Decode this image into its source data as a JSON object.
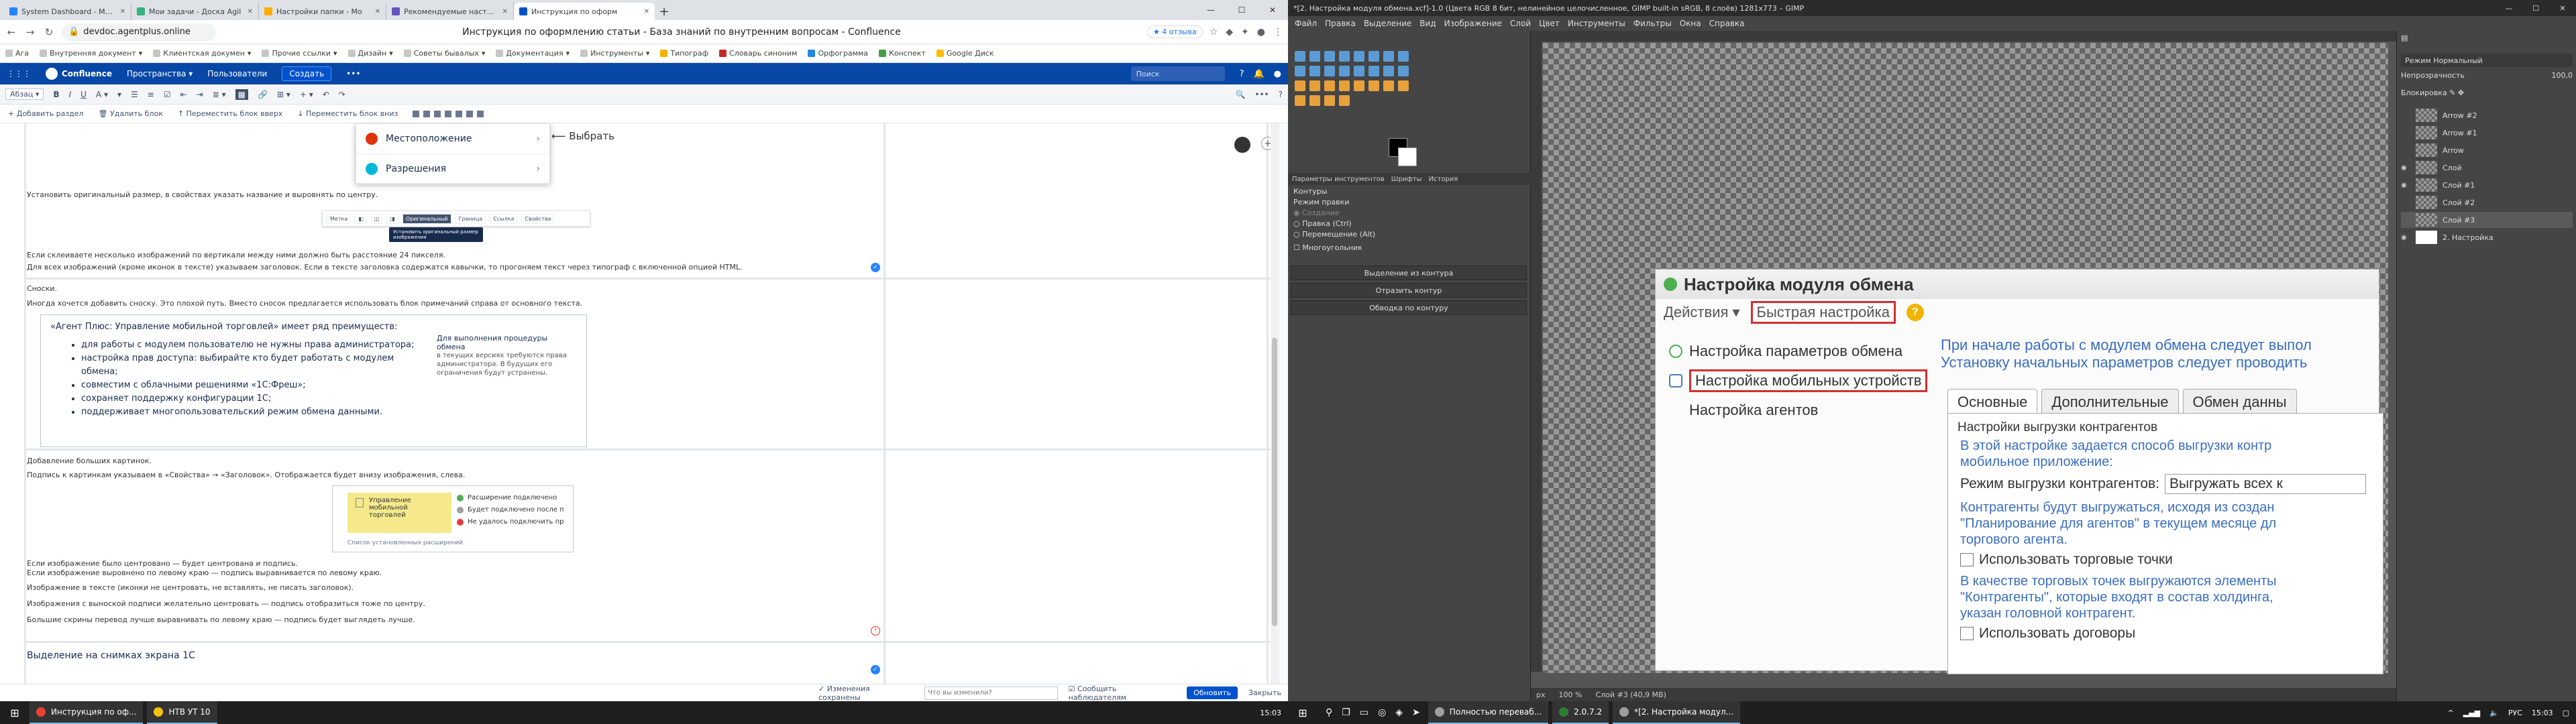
{
  "browser": {
    "tabs": [
      {
        "label": "System Dashboard - MT Н",
        "color": "#2684ff"
      },
      {
        "label": "Мои задачи - Доска Agil",
        "color": "#36b37e"
      },
      {
        "label": "Настройки папки - Мо",
        "color": "#ffab00"
      },
      {
        "label": "Рекомендуемые настрой",
        "color": "#6554c0"
      },
      {
        "label": "Инструкция по оформ",
        "color": "#0052cc",
        "active": true
      }
    ],
    "new_tab": "+",
    "address": "devdoc.agentplus.online",
    "title": "Инструкция по оформлению статьи - База знаний по внутренним вопросам - Confluence",
    "reviews": "★ 4 отзыва",
    "bookmarks": [
      "Ага",
      "Внутренняя документ",
      "Клиентская докумен",
      "Прочие ссылки",
      "Дизайн",
      "Советы бывалых",
      "Документация",
      "Инструменты",
      "Типограф",
      "Словарь синоним",
      "Орфограмма",
      "Конспект",
      "Google Диск"
    ]
  },
  "confluence": {
    "brand": "Confluence",
    "nav": [
      "Пространства",
      "Пользователи"
    ],
    "create": "Создать",
    "search_placeholder": "Поиск",
    "format_select": "Абзац",
    "actions": [
      "Добавить раздел",
      "Удалить блок",
      "Переместить блок вверх",
      "Переместить блок вниз"
    ],
    "popup": {
      "item1": "Местоположение",
      "item2": "Разрешения",
      "choose": "Выбрать"
    },
    "image_toolbar": [
      "Метка",
      "Оригинальный",
      "Граница",
      "Ссылка",
      "Свойства"
    ],
    "tooltip": "Установить оригинальный размер изображения",
    "texts": {
      "t1": "Установить оригинальный размер, в свойствах указать название и выровнять по центру.",
      "t2": "Если склеиваете несколько изображений по вертикали между ними должно быть расстояние 24 пикселя.",
      "t3": "Для всех изображений (кроме иконок в тексте) указываем заголовок. Если в тексте заголовка содержатся кавычки, то прогоняем текст через типограф с включенной опцией HTML.",
      "t4": "Сноски.",
      "t5": "Иногда хочется добавить сноску. Это плохой путь. Вместо сносок предлагается использовать блок примечаний справа от основного текста.",
      "t6": "Добавление больших картинок.",
      "t7": "Подпись к картинкам указываем в «Свойства» → «Заголовок». Отображается будет внизу изображения, слева.",
      "t8": "Если изображение было центровано — будет центрована и подпись.",
      "t9": "Если изображение выровнено по левому краю — подпись выравнивается по левому краю.",
      "t10": "Изображение в тексте (иконки не центровать, не вставлять, не писать заголовок).",
      "t11": "Изображения с выноской подписи желательно центровать — подпись отобразиться тоже по центру.",
      "t12": "Большие скрины перевод лучше выравнивать по левому краю — подпись будет выглядеть лучше.",
      "heading": "Выделение на снимках экрана 1С"
    },
    "panel": {
      "heading": "«Агент Плюс: Управление мобильной торговлей» имеет ряд преимуществ:",
      "bullets": [
        "для работы с модулем пользователю не нужны права администратора;",
        "настройка прав доступа: выбирайте кто будет работать с модулем обмена;",
        "совместим с облачными решениями «1С:Фреш»;",
        "сохраняет поддержку конфигурации 1С;",
        "поддерживает многопользовательский режим обмена данными."
      ],
      "side_title": "Для выполнения процедуры обмена",
      "side_text": "в текущих версиях требуются права администратора. В будущих его ограничения будут устранены."
    },
    "image_box": {
      "label": "Управление мобильной торговлей",
      "opt1": "Расширение подключено",
      "opt2": "Будет подключено после п",
      "opt3": "Не удалось подключить пр",
      "caption": "Список установленных расширений"
    },
    "footer": {
      "changes": "Изменения сохранены",
      "input_placeholder": "Что вы изменили?",
      "notify": "Сообщить наблюдателям",
      "publish": "Обновить",
      "close": "Закрыть"
    }
  },
  "taskbar_left": {
    "items": [
      "Инструкция по оф...",
      "НТВ УТ 10"
    ],
    "time": "15:03"
  },
  "gimp": {
    "title": "*[2. Настройка модуля обмена.xcf]-1.0 (Цвета RGB 8 бит, нелинейное целочисленное, GIMP built-in sRGB, 8 слоёв) 1281x773 – GIMP",
    "menu": [
      "Файл",
      "Правка",
      "Выделение",
      "Вид",
      "Изображение",
      "Слой",
      "Цвет",
      "Инструменты",
      "Фильтры",
      "Окна",
      "Справка"
    ],
    "tabs": [
      "Параметры инструментов",
      "Шрифты",
      "История"
    ],
    "options": {
      "contours": "Контуры",
      "mode": "Режим правки",
      "create": "Создание",
      "edit": "Правка (Ctrl)",
      "move": "Перемещение (Alt)",
      "poly": "Многоугольник"
    },
    "buttons": [
      "Выделение из контура",
      "Отразить контур",
      "Обводка по контуру"
    ],
    "status": {
      "unit": "px",
      "zoom": "100 %",
      "layer": "Слой #3 (40,9 MB)"
    },
    "layers_mode": "Режим Нормальный",
    "opacity_label": "Непрозрачность",
    "opacity_value": "100,0",
    "lock_label": "Блокировка",
    "layers": [
      {
        "name": "Arrow #2",
        "visible": false
      },
      {
        "name": "Arrow #1",
        "visible": false
      },
      {
        "name": "Arrow",
        "visible": false
      },
      {
        "name": "Слой",
        "visible": true
      },
      {
        "name": "Слой #1",
        "visible": true
      },
      {
        "name": "Слой #2",
        "visible": false
      },
      {
        "name": "Слой #3",
        "visible": false
      },
      {
        "name": "2. Настройка",
        "visible": true
      }
    ]
  },
  "dialog1c": {
    "title": "Настройка модуля обмена",
    "actions": "Действия ▾",
    "quick": "Быстрая настройка",
    "help": "?",
    "left": [
      "Настройка параметров обмена",
      "Настройка мобильных устройств",
      "Настройка агентов"
    ],
    "info1": "При начале работы с модулем обмена следует выпол",
    "info2": "Установку начальных параметров следует проводить",
    "tabs": [
      "Основные",
      "Дополнительные",
      "Обмен данны"
    ],
    "group": "Настройки выгрузки контрагентов",
    "blue1": "В этой настройке задается способ выгрузки контр",
    "blue2": "мобильное приложение:",
    "mode_label": "Режим выгрузки контрагентов:",
    "mode_value": "Выгружать всех к",
    "blue3": "Контрагенты будут выгружаться, исходя из создан",
    "blue4": "\"Планирование для агентов\" в текущем месяце дл",
    "blue5": "торгового агента.",
    "chk1": "Использовать торговые точки",
    "blue6": "В качестве торговых точек выгружаются элементы",
    "blue7": "\"Контрагенты\", которые входят в состав холдинга,",
    "blue8": "указан головной контрагент.",
    "chk2": "Использовать договоры"
  },
  "taskbar_right": {
    "items": [
      "Полностью переваб...",
      "2.0.7.2",
      "*[2. Настройка модул..."
    ],
    "time": "15:03",
    "lang": "РУС"
  }
}
